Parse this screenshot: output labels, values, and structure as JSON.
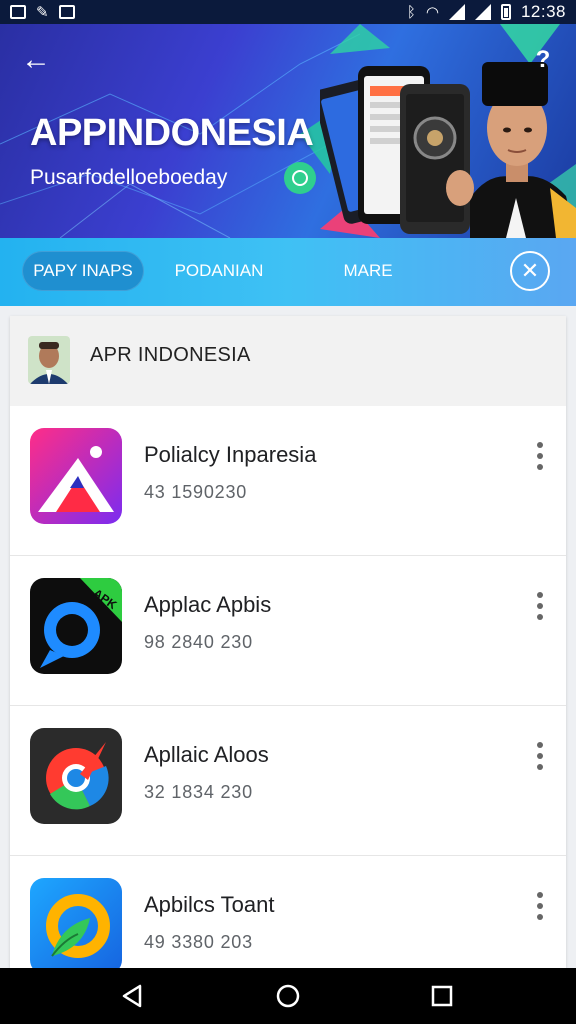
{
  "status_bar": {
    "time": "12:38"
  },
  "banner": {
    "title": "APPINDONESIA",
    "subtitle": "Pusarfodelloeboeday",
    "back_icon": "arrow-left-icon",
    "help_label": "?"
  },
  "tabs": [
    {
      "label": "PAPY INAPS",
      "active": true
    },
    {
      "label": "PODANIAN",
      "active": false
    },
    {
      "label": "MARE",
      "active": false
    }
  ],
  "section": {
    "title": "APR INDONESIA"
  },
  "apps": [
    {
      "name": "Polialcy Inparesia",
      "meta": "43 1590230",
      "icon": "mountain-icon"
    },
    {
      "name": "Applac Apbis",
      "meta": "98 2840 230",
      "icon": "search-bubble-icon"
    },
    {
      "name": "Apllaic Aloos",
      "meta": "32 1834 230",
      "icon": "compass-icon"
    },
    {
      "name": "Apbilcs Toant",
      "meta": "49 3380 203",
      "icon": "leaf-circle-icon"
    }
  ],
  "colors": {
    "banner_start": "#2a2fa3",
    "tabbar": "#3fc1f4",
    "active_tab": "#1f8fd0"
  }
}
